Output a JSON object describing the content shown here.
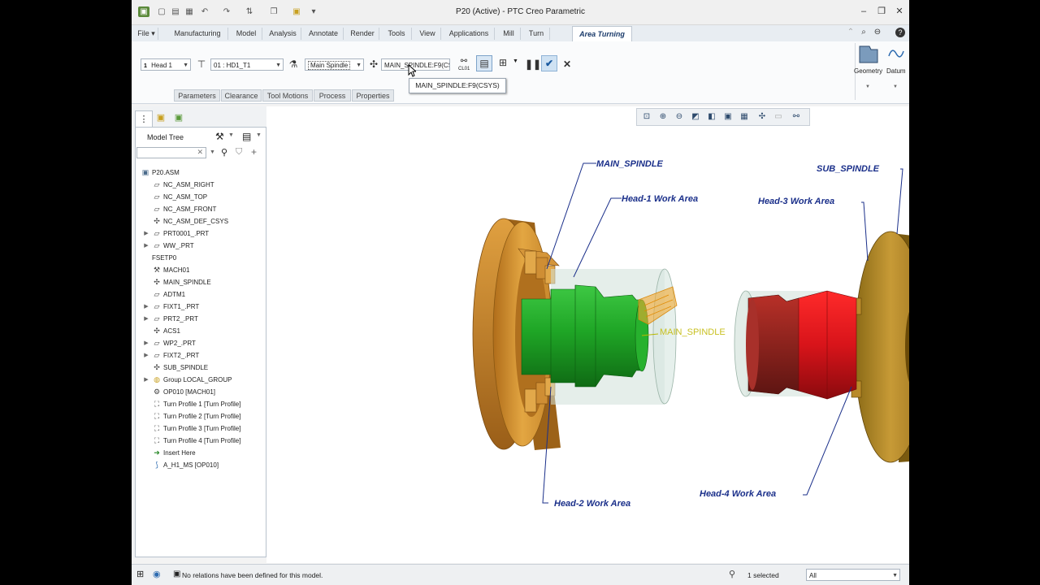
{
  "window": {
    "title": "P20 (Active) - PTC Creo Parametric"
  },
  "quick_access": [
    "app-icon",
    "new-icon",
    "open-icon",
    "save-icon",
    "undo-icon",
    "redo-icon",
    "regenerate-icon",
    "windows-icon",
    "close-window-icon",
    "customize-icon"
  ],
  "ribbon_tabs": [
    "File ▾",
    "Manufacturing",
    "Model",
    "Analysis",
    "Annotate",
    "Render",
    "Tools",
    "View",
    "Applications",
    "Mill",
    "Turn",
    "Area Turning"
  ],
  "ribbon": {
    "head_select": "Head 1",
    "head_number": "1",
    "tool_select": "01 : HD1_T1",
    "spindle_select": "Main Spindle",
    "csys_field": "MAIN_SPINDLE:F9(CS",
    "clearance_label": "CL01",
    "geometry_label": "Geometry",
    "datum_label": "Datum",
    "subtabs": [
      "Parameters",
      "Clearance",
      "Tool Motions",
      "Process",
      "Properties"
    ],
    "tooltip": "MAIN_SPINDLE:F9(CSYS)"
  },
  "model_tree": {
    "title": "Model Tree",
    "search_placeholder": "",
    "items": [
      {
        "label": "P20.ASM",
        "indent": 0,
        "icon": "assembly-icon",
        "expand": ""
      },
      {
        "label": "NC_ASM_RIGHT",
        "indent": 1,
        "icon": "datum-plane-icon",
        "expand": ""
      },
      {
        "label": "NC_ASM_TOP",
        "indent": 1,
        "icon": "datum-plane-icon",
        "expand": ""
      },
      {
        "label": "NC_ASM_FRONT",
        "indent": 1,
        "icon": "datum-plane-icon",
        "expand": ""
      },
      {
        "label": "NC_ASM_DEF_CSYS",
        "indent": 1,
        "icon": "csys-icon",
        "expand": ""
      },
      {
        "label": "PRT0001_.PRT",
        "indent": 1,
        "icon": "part-icon",
        "expand": "▶"
      },
      {
        "label": "WW_.PRT",
        "indent": 1,
        "icon": "part-icon",
        "expand": "▶"
      },
      {
        "label": "FSETP0",
        "indent": 1,
        "icon": "",
        "expand": ""
      },
      {
        "label": "MACH01",
        "indent": 1,
        "icon": "machine-icon",
        "expand": ""
      },
      {
        "label": "MAIN_SPINDLE",
        "indent": 1,
        "icon": "csys-icon",
        "expand": ""
      },
      {
        "label": "ADTM1",
        "indent": 1,
        "icon": "datum-plane-icon",
        "expand": ""
      },
      {
        "label": "FIXT1_.PRT",
        "indent": 1,
        "icon": "part-icon",
        "expand": "▶"
      },
      {
        "label": "PRT2_.PRT",
        "indent": 1,
        "icon": "part-icon",
        "expand": "▶"
      },
      {
        "label": "ACS1",
        "indent": 1,
        "icon": "csys-icon",
        "expand": ""
      },
      {
        "label": "WP2_.PRT",
        "indent": 1,
        "icon": "part-icon",
        "expand": "▶"
      },
      {
        "label": "FIXT2_.PRT",
        "indent": 1,
        "icon": "part-icon",
        "expand": "▶"
      },
      {
        "label": "SUB_SPINDLE",
        "indent": 1,
        "icon": "csys-icon",
        "expand": ""
      },
      {
        "label": "Group LOCAL_GROUP",
        "indent": 1,
        "icon": "group-icon",
        "expand": "▶"
      },
      {
        "label": "OP010 [MACH01]",
        "indent": 1,
        "icon": "operation-icon",
        "expand": ""
      },
      {
        "label": "Turn Profile 1 [Turn Profile]",
        "indent": 1,
        "icon": "turn-profile-icon",
        "expand": ""
      },
      {
        "label": "Turn Profile 2 [Turn Profile]",
        "indent": 1,
        "icon": "turn-profile-icon",
        "expand": ""
      },
      {
        "label": "Turn Profile 3 [Turn Profile]",
        "indent": 1,
        "icon": "turn-profile-icon",
        "expand": ""
      },
      {
        "label": "Turn Profile 4 [Turn Profile]",
        "indent": 1,
        "icon": "turn-profile-icon",
        "expand": ""
      },
      {
        "label": "Insert Here",
        "indent": 1,
        "icon": "insert-arrow-icon",
        "expand": ""
      },
      {
        "label": "A_H1_MS [OP010]",
        "indent": 1,
        "icon": "area-turning-icon",
        "expand": ""
      }
    ]
  },
  "graphics": {
    "labels": {
      "main_spindle": "MAIN_SPINDLE",
      "sub_spindle": "SUB_SPINDLE",
      "head1": "Head-1 Work Area",
      "head2": "Head-2 Work Area",
      "head3": "Head-3 Work Area",
      "head4": "Head-4 Work Area",
      "csys_tag": "MAIN_SPINDLE"
    },
    "colors": {
      "chuck": "#d89a3a",
      "chuck_dark": "#a66a1c",
      "sub_chuck": "#b98a2e",
      "workpiece_green": "#22a52a",
      "workpiece_red": "#d8181e",
      "stock_transparent": "#cfe0d8",
      "leader": "#1a2f8a"
    }
  },
  "status": {
    "message": "No relations have been defined for this model.",
    "selected": "1 selected",
    "filter": "All"
  }
}
